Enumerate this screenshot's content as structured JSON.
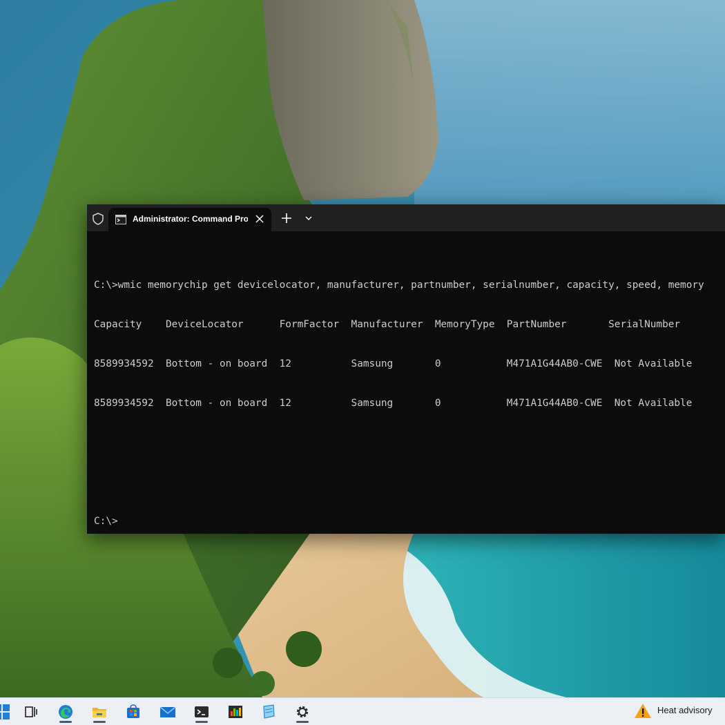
{
  "window": {
    "tab_title": "Administrator: Command Prompt",
    "icons": [
      "shield-icon",
      "cmd-icon",
      "close-icon",
      "plus-icon",
      "chevron-down-icon"
    ]
  },
  "console": {
    "lines": [
      "C:\\>wmic memorychip get devicelocator, manufacturer, partnumber, serialnumber, capacity, speed, memory",
      "Capacity    DeviceLocator      FormFactor  Manufacturer  MemoryType  PartNumber       SerialNumber",
      "8589934592  Bottom - on board  12          Samsung       0           M471A1G44AB0-CWE  Not Available",
      "8589934592  Bottom - on board  12          Samsung       0           M471A1G44AB0-CWE  Not Available",
      "",
      "",
      "C:\\>"
    ]
  },
  "taskbar": {
    "items": [
      "windows-logo-icon",
      "task-view-icon",
      "edge-icon",
      "file-explorer-icon",
      "microsoft-store-icon",
      "mail-icon",
      "terminal-icon",
      "taskmanager-icon",
      "notepad-icon",
      "settings-icon"
    ],
    "weather": {
      "label": "Heat advisory",
      "icon": "warning-icon"
    }
  },
  "colors": {
    "console_bg": "#0c0c0c",
    "console_text": "#cccccc",
    "titlebar_bg": "#202020",
    "taskbar_bg": "#ecf0f4"
  }
}
